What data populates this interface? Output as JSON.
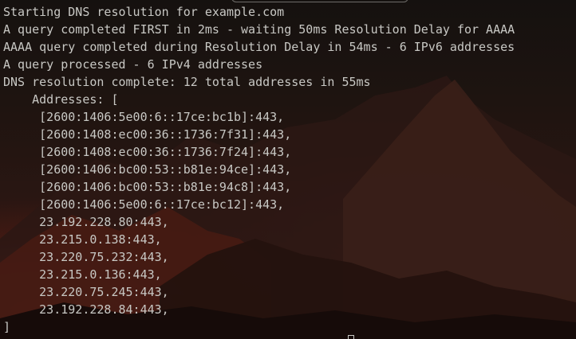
{
  "terminal": {
    "lines": [
      "Starting DNS resolution for example.com",
      "A query completed FIRST in 2ms - waiting 50ms Resolution Delay for AAAA",
      "AAAA query completed during Resolution Delay in 54ms - 6 IPv6 addresses",
      "A query processed - 6 IPv4 addresses",
      "DNS resolution complete: 12 total addresses in 55ms",
      "    Addresses: [",
      "     [2600:1406:5e00:6::17ce:bc1b]:443,",
      "     [2600:1408:ec00:36::1736:7f31]:443,",
      "     [2600:1408:ec00:36::1736:7f24]:443,",
      "     [2600:1406:bc00:53::b81e:94ce]:443,",
      "     [2600:1406:bc00:53::b81e:94c8]:443,",
      "     [2600:1406:5e00:6::17ce:bc12]:443,",
      "     23.192.228.80:443,",
      "     23.215.0.138:443,",
      "     23.220.75.232:443,",
      "     23.215.0.136:443,",
      "     23.220.75.245:443,",
      "     23.192.228.84:443,",
      "]"
    ]
  },
  "colors": {
    "text": "#c8c8c4",
    "background_dark": "#1a0f0c",
    "background_glow": "#be3723"
  },
  "icons": {
    "cursor": "block-cursor-icon"
  }
}
